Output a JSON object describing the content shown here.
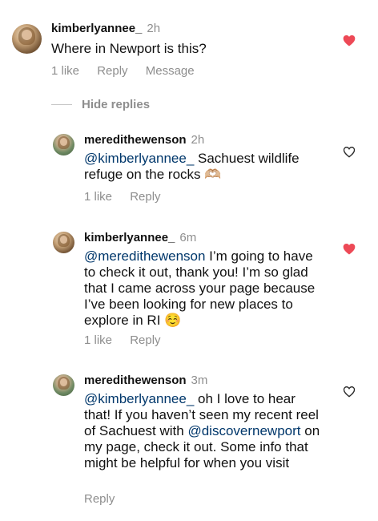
{
  "comments": [
    {
      "username": "kimberlyannee_",
      "time": "2h",
      "mention": "",
      "text": "Where in Newport is this?",
      "likes": "1 like",
      "reply": "Reply",
      "message": "Message",
      "liked": true
    },
    {
      "username": "meredithewenson",
      "time": "2h",
      "mention": "@kimberlyannee_",
      "text": " Sachuest wildlife refuge on the rocks 🫶🏼",
      "likes": "1 like",
      "reply": "Reply",
      "liked": false
    },
    {
      "username": "kimberlyannee_",
      "time": "6m",
      "mention": "@meredithewenson",
      "text": " I’m going to have to check it out, thank you! I’m so glad that I came across your page because I’ve been looking for new places to explore in RI ☺️",
      "likes": "1 like",
      "reply": "Reply",
      "liked": true
    },
    {
      "username": "meredithewenson",
      "time": "3m",
      "mention": "@kimberlyannee_",
      "text_a": " oh I love to hear that! If you haven’t seen my recent reel of Sachuest with ",
      "mention2": "@discovernewport",
      "text_b": " on my page, check it out. Some info that might be helpful for when you visit",
      "reply": "Reply",
      "liked": false
    }
  ],
  "hide_replies_label": "Hide replies",
  "colors": {
    "liked_heart": "#ed4956",
    "mention": "#00376b",
    "secondary_text": "#8e8e8e"
  }
}
